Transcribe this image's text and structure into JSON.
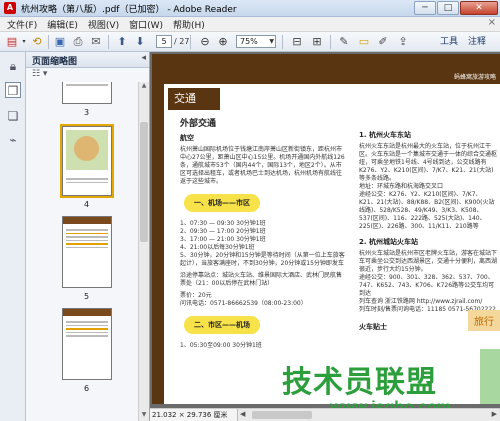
{
  "window": {
    "title": "杭州攻略（第八版）.pdf（已加密） - Adobe Reader",
    "minimize": "─",
    "maximize": "□",
    "close": "✕"
  },
  "menu": {
    "items": [
      "文件(F)",
      "编辑(E)",
      "视图(V)",
      "窗口(W)",
      "帮助(H)"
    ],
    "close": "×"
  },
  "toolbar": {
    "page_current": "5",
    "page_total": "/ 27",
    "zoom": "75%",
    "tools_label": "工具",
    "comment_label": "注释"
  },
  "thumb_panel": {
    "title": "页面缩略图",
    "pages": [
      "3",
      "4",
      "5",
      "6"
    ],
    "selected_page": "4"
  },
  "document": {
    "section": "交通",
    "brand": "蚂蜂窝旅游攻略",
    "col1_heading": "外部交通",
    "airport": "航空",
    "airport_text": "杭州萧山国际机场位于钱塘江南岸萧山区新街镇东，距杭州市中心27公里，距萧山区中心15公里。机场开通国内外航线126条，通航城市53个（国内44个，国际13个，地区2个）。从市区可选择出租车，或者机场巴士到达机场，杭州机场有航线往返于这些城市。",
    "pill1": "一、机场——市区",
    "bus_lines": [
      "1、07:30 — 09:30 30分钟1班",
      "2、09:30 — 17:00 20分钟1班",
      "3、17:00 — 21:00 30分钟1班",
      "4、21:00以后每30分钟1班",
      "5、30分钟，20分钟和15分钟是等待时间（从第一位上车旅客起计），当旅客满座时，不到30分钟，20分钟或15分钟即发车"
    ],
    "stop_text": "沿途停靠站点：城站火车站、维景国际大酒店、武林门民航售票处（21：00以后停在武林门站）",
    "fare": "票价：20元",
    "phone": "问讯电话：0571-86662539（08:00-23:00）",
    "pill2": "二、市区——机场",
    "bus_line2": "1、05:30至09:00 30分钟1班",
    "col2_heading": "1. 杭州火车东站",
    "col2_text": "杭州火车东站是杭州最大的火车站，位于杭州江干区。火车东站是一个集城市交通于一体的综合交通枢纽，可乘坐地铁1号线、4号线到达，公交线路有K276、Y2、K210(区间)、7/K7、K21、21(大站)等多条线路。",
    "col2_address": "地址：环城东路和杭海路交叉口",
    "col2_buses": "途经公交：K276、Y2、K210(区间)、7/K7、K21、21(大站)、88/K88、B2(区间)、K900(火站线路)、528/K528、49/K49、3/K3、K508、537(区间)、116、222路、525(大站)、140、225(区)、226路、300、11/K11、210路等",
    "col2_heading2": "2. 杭州城站火车站",
    "col2_text2": "杭州火车城站是杭州市区老牌火车站，游客在城站下车可乘坐公交到达西湖景区，交通十分便利，离西湖很近，步行大约15分钟。",
    "col2_buses2": "途经公交：900、301、328、362、537、700、747、K652、743、K706、K726路等公交车均可到达",
    "col2_web": "列车查询 浙江铁路网 http://www.zjrail.com/",
    "col2_phone": "列车时刻/售票问询电话：11185 0571-56702222",
    "train_tag": "旅行",
    "train_sub": "火车贴士",
    "page_size": "21.032 × 29.736 厘米"
  },
  "watermark": {
    "cn": "技术员联盟",
    "url": "www.jsgho.com"
  }
}
